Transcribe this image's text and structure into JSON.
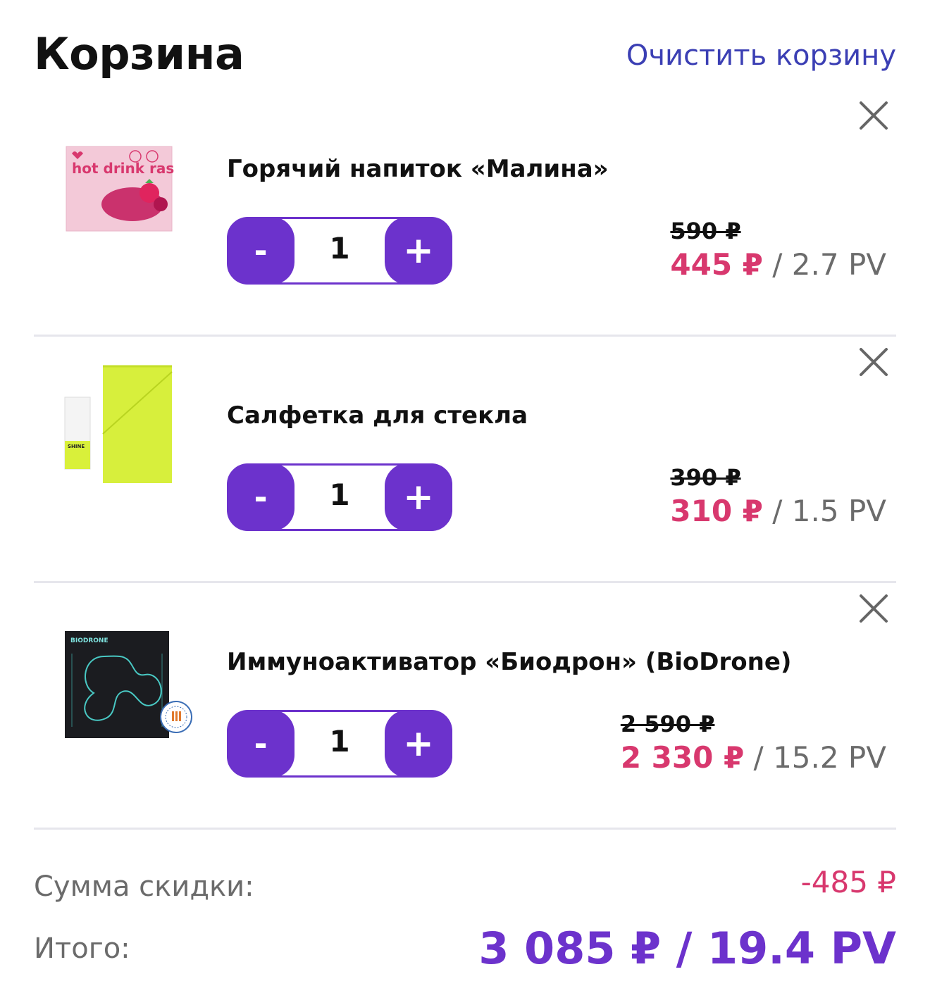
{
  "header": {
    "title": "Корзина",
    "clear_label": "Очистить корзину"
  },
  "items": [
    {
      "name": "Горячий напиток «Малина»",
      "quantity": "1",
      "old_price": "590 ₽",
      "new_price": "445 ₽",
      "separator": "/",
      "pv": "2.7 PV",
      "image": {
        "brand_text": "hot drink raspberry",
        "icon": "raspberry-drink-box"
      }
    },
    {
      "name": "Салфетка для стекла",
      "quantity": "1",
      "old_price": "390 ₽",
      "new_price": "310 ₽",
      "separator": "/",
      "pv": "1.5 PV",
      "image": {
        "brand_text": "SHINE",
        "icon": "glass-cloth"
      }
    },
    {
      "name": "Иммуноактиватор «Биодрон» (BioDrone)",
      "quantity": "1",
      "old_price": "2 590 ₽",
      "new_price": "2 330 ₽",
      "separator": "/",
      "pv": "15.2 PV",
      "image": {
        "brand_text": "BIODRONE",
        "icon": "biodrone-box"
      }
    }
  ],
  "controls": {
    "minus": "-",
    "plus": "+"
  },
  "summary": {
    "discount_label": "Сумма скидки:",
    "discount_value": "-485 ₽",
    "total_label": "Итого:",
    "total_value": "3 085 ₽ / 19.4 PV"
  },
  "colors": {
    "accent": "#6c32cc",
    "sale": "#d8386e",
    "link": "#3b3fb4",
    "muted": "#6b6b6b"
  }
}
